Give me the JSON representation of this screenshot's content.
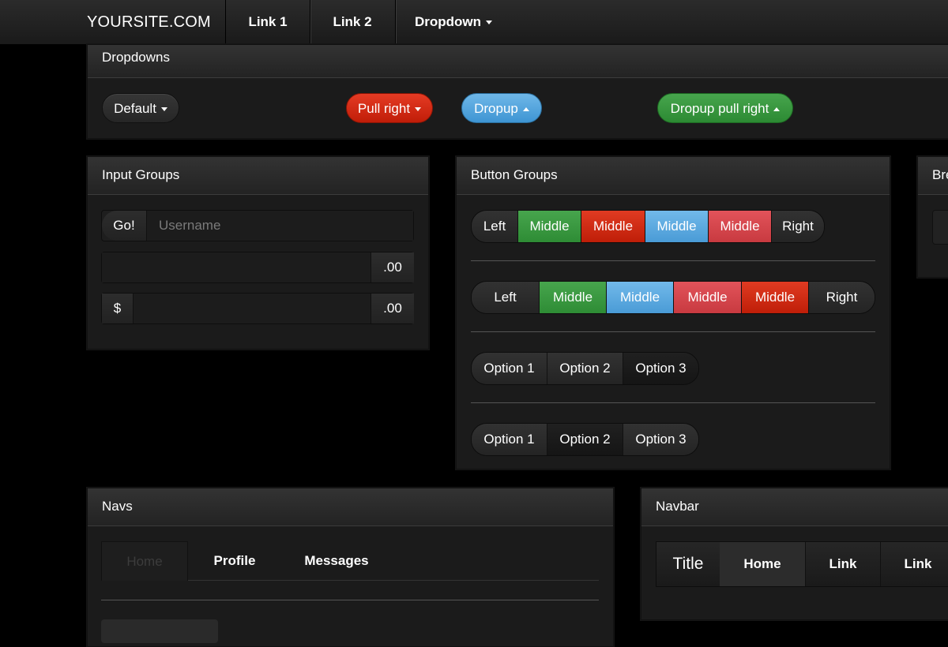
{
  "topnav": {
    "brand": "YOURSITE.COM",
    "link1": "Link 1",
    "link2": "Link 2",
    "dropdown": "Dropdown"
  },
  "dropdowns": {
    "title": "Dropdowns",
    "default_label": "Default",
    "pull_right_label": "Pull right",
    "dropup_label": "Dropup",
    "dropup_pull_right_label": "Dropup pull right"
  },
  "input_groups": {
    "title": "Input Groups",
    "go_label": "Go!",
    "username_placeholder": "Username",
    "suffix_1": ".00",
    "dollar": "$",
    "suffix_2": ".00"
  },
  "button_groups": {
    "title": "Button Groups",
    "group1": [
      "Left",
      "Middle",
      "Middle",
      "Middle",
      "Middle",
      "Right"
    ],
    "group2": [
      "Left",
      "Middle",
      "Middle",
      "Middle",
      "Middle",
      "Right"
    ],
    "group3": [
      "Option 1",
      "Option 2",
      "Option 3"
    ],
    "group4": [
      "Option 1",
      "Option 2",
      "Option 3"
    ]
  },
  "breadcrumbs": {
    "title_partial": "Bre"
  },
  "navs": {
    "title": "Navs",
    "tabs": [
      "Home",
      "Profile",
      "Messages"
    ]
  },
  "navbar": {
    "title": "Navbar",
    "brand": "Title",
    "items": [
      "Home",
      "Link",
      "Link"
    ]
  },
  "colors": {
    "red": "#c9240d",
    "blue": "#4a9bd6",
    "green": "#2e8c35",
    "rose": "#c83a40"
  }
}
